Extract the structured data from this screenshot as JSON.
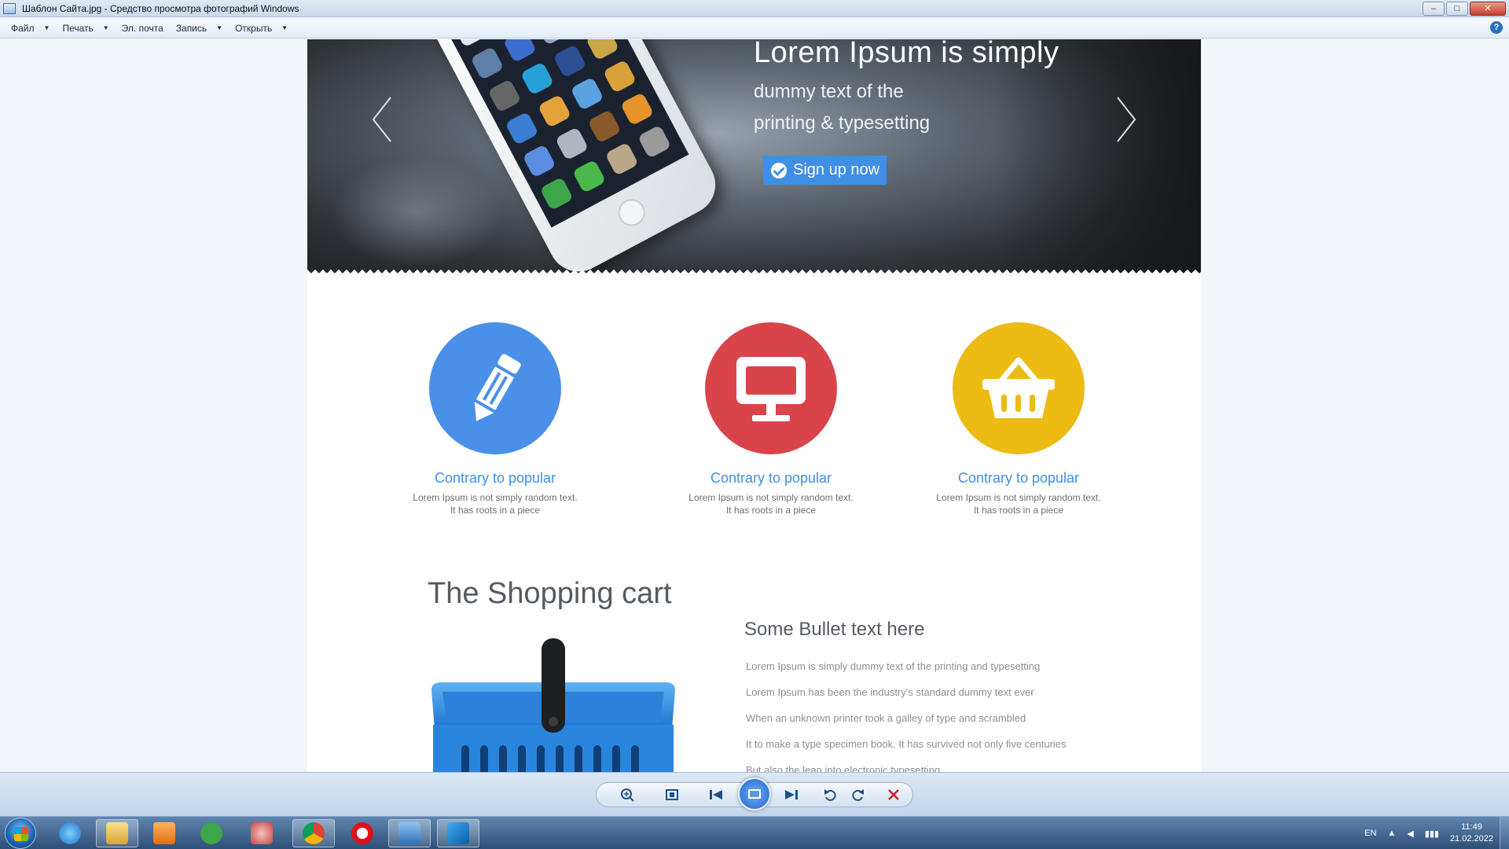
{
  "window": {
    "title": "Шаблон Сайта.jpg - Средство просмотра фотографий Windows",
    "controls": {
      "minimize": "–",
      "maximize": "□",
      "close": "✕"
    }
  },
  "menu": {
    "items": [
      {
        "label": "Файл",
        "has_dropdown": true
      },
      {
        "label": "Печать",
        "has_dropdown": true
      },
      {
        "label": "Эл. почта",
        "has_dropdown": false
      },
      {
        "label": "Запись",
        "has_dropdown": true
      },
      {
        "label": "Открыть",
        "has_dropdown": true
      }
    ],
    "help": "?"
  },
  "photo": {
    "hero": {
      "title": "Lorem Ipsum is simply",
      "subtitle_line1": "dummy text of the",
      "subtitle_line2": "printing & typesetting",
      "cta": "Sign up now"
    },
    "features": [
      {
        "icon": "pencil-icon",
        "color": "#4a90e8",
        "title": "Contrary to popular",
        "desc_line1": "Lorem Ipsum is not simply random text.",
        "desc_line2": "It has roots in a piece"
      },
      {
        "icon": "monitor-icon",
        "color": "#d9434a",
        "title": "Contrary to popular",
        "desc_line1": "Lorem Ipsum is not simply random text.",
        "desc_line2": "It has roots in a piece"
      },
      {
        "icon": "basket-icon",
        "color": "#ecbb14",
        "title": "Contrary to popular",
        "desc_line1": "Lorem Ipsum is not simply random text.",
        "desc_line2": "It has roots in a piece"
      }
    ],
    "cart_section": {
      "title": "The Shopping cart",
      "bullet_title": "Some Bullet text here",
      "bullets": [
        "Lorem Ipsum is simply dummy text of the printing and typesetting",
        "Lorem Ipsum has been the industry's standard dummy text ever",
        "When an unknown printer took a galley of type and scrambled",
        "It to make a type specimen book. It has survived not only five centuries",
        "But also the leap into electronic typesetting"
      ]
    }
  },
  "taskbar": {
    "apps": [
      "start-button",
      "internet-explorer",
      "file-explorer",
      "media-player",
      "vivaldi",
      "snipping-tool",
      "chrome",
      "opera",
      "photo-viewer",
      "vscode"
    ],
    "language": "EN",
    "time": "11:49",
    "date": "21.02.2022"
  },
  "colors": {
    "accent": "#3f8fe6",
    "blue": "#4a90e8",
    "red": "#d9434a",
    "yellow": "#ecbb14"
  }
}
